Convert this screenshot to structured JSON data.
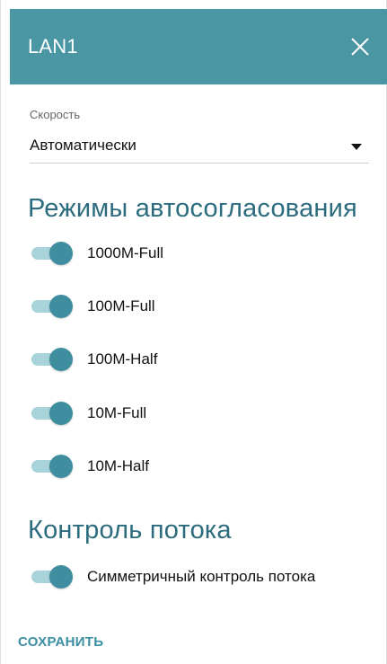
{
  "header": {
    "title": "LAN1",
    "close_icon": "close-icon",
    "bg_color": "#4a96a3"
  },
  "speed": {
    "label": "Скорость",
    "value": "Автоматически",
    "caret_icon": "caret-down-icon"
  },
  "autoneg": {
    "title": "Режимы автосогласования",
    "items": [
      {
        "label": "1000M-Full",
        "enabled": true
      },
      {
        "label": "100M-Full",
        "enabled": true
      },
      {
        "label": "100M-Half",
        "enabled": true
      },
      {
        "label": "10M-Full",
        "enabled": true
      },
      {
        "label": "10M-Half",
        "enabled": true
      }
    ]
  },
  "flow_control": {
    "title": "Контроль потока",
    "symmetric": {
      "label": "Симметричный контроль потока",
      "enabled": true
    }
  },
  "actions": {
    "save_label": "СОХРАНИТЬ"
  },
  "colors": {
    "accent": "#3a8fa3",
    "section_title": "#2c6c7e",
    "toggle_track": "#a9d3db",
    "toggle_thumb": "#3f8ea0"
  }
}
